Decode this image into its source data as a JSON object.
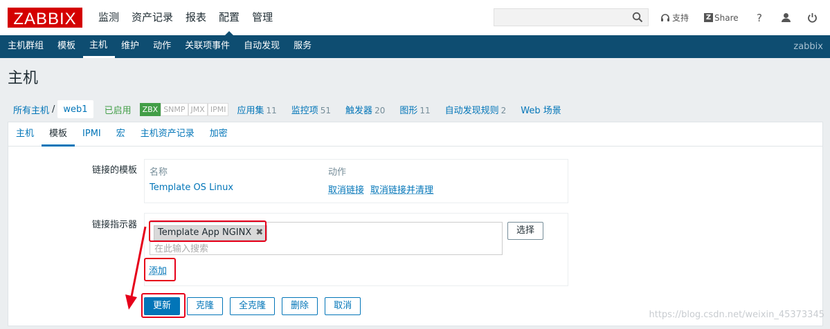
{
  "header": {
    "logo": "ZABBIX",
    "menu": [
      "监测",
      "资产记录",
      "报表",
      "配置",
      "管理"
    ],
    "search_placeholder": "",
    "support": "支持",
    "share": "Share",
    "help": "?"
  },
  "subnav": {
    "items": [
      "主机群组",
      "模板",
      "主机",
      "维护",
      "动作",
      "关联项事件",
      "自动发现",
      "服务"
    ],
    "brand": "zabbix"
  },
  "page_title": "主机",
  "breadcrumb": {
    "all_hosts": "所有主机",
    "sep": "/",
    "host": "web1",
    "status": "已启用",
    "badges": [
      "ZBX",
      "SNMP",
      "JMX",
      "IPMI"
    ],
    "links": [
      {
        "label": "应用集",
        "count": "11"
      },
      {
        "label": "监控项",
        "count": "51"
      },
      {
        "label": "触发器",
        "count": "20"
      },
      {
        "label": "图形",
        "count": "11"
      },
      {
        "label": "自动发现规则",
        "count": "2"
      },
      {
        "label": "Web 场景",
        "count": ""
      }
    ]
  },
  "tabs": [
    "主机",
    "模板",
    "IPMI",
    "宏",
    "主机资产记录",
    "加密"
  ],
  "form": {
    "linked_label": "链接的模板",
    "col_name": "名称",
    "col_action": "动作",
    "template_name": "Template OS Linux",
    "unlink": "取消链接",
    "unlink_clear": "取消链接并清理",
    "link_label": "链接指示器",
    "chip": "Template App NGINX",
    "chip_x": "✖",
    "placeholder": "在此输入搜索",
    "select": "选择",
    "add": "添加"
  },
  "buttons": [
    "更新",
    "克隆",
    "全克隆",
    "删除",
    "取消"
  ],
  "watermark": "https://blog.csdn.net/weixin_45373345",
  "colors": {
    "brand_red": "#d40000",
    "nav_blue": "#0e4d71",
    "link_blue": "#0275b8",
    "highlight_red": "#e6001a",
    "enabled_green": "#429e47"
  }
}
